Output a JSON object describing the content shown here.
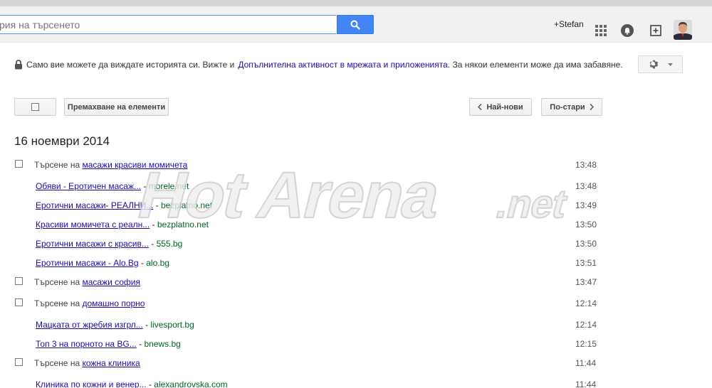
{
  "search": {
    "placeholder": "рия на търсенето"
  },
  "header": {
    "user_label": "+Stefan"
  },
  "notice": {
    "text_before": "Само вие можете да виждате историята си. Вижте и",
    "link": "Допълнителна активност в мрежата и приложенията",
    "text_after": ". За някои елементи може да има забавяне."
  },
  "toolbar": {
    "remove_label": "Премахване на елементи",
    "newer_label": "Най-нови",
    "older_label": "По-стари"
  },
  "date_heading": "16 ноември 2014",
  "history": [
    {
      "kind": "query",
      "prefix": "Търсене на ",
      "term": "масажи красиви момичета",
      "time": "13:48"
    },
    {
      "kind": "result",
      "title": "Обяви - Еротичен масаж...",
      "domain": "morele.net",
      "time": "13:48"
    },
    {
      "kind": "result",
      "title": "Еротични масажи- РЕАЛНИ...",
      "domain": "bezplatno.net",
      "time": "13:49"
    },
    {
      "kind": "result",
      "title": "Красиви момичета с реалн...",
      "domain": "bezplatno.net",
      "time": "13:50"
    },
    {
      "kind": "result",
      "title": "Еротични масажи с красив...",
      "domain": "555.bg",
      "time": "13:50"
    },
    {
      "kind": "result",
      "title": "Еротични масажи - Alo.Bg",
      "domain": "alo.bg",
      "time": "13:51"
    },
    {
      "kind": "query",
      "prefix": "Търсене на ",
      "term": "масажи софия",
      "time": "13:47"
    },
    {
      "kind": "query",
      "prefix": "Търсене на ",
      "term": "домашно порно",
      "time": "12:14"
    },
    {
      "kind": "result",
      "title": "Мацката от жребия изгрл...",
      "domain": "livesport.bg",
      "time": "12:14"
    },
    {
      "kind": "result",
      "title": "Топ 3 на порното на BG...",
      "domain": "bnews.bg",
      "time": "12:15"
    },
    {
      "kind": "query",
      "prefix": "Търсене на ",
      "term": "кожна клиника",
      "time": "11:44"
    },
    {
      "kind": "result",
      "title": "Клиника по кожни и венер...",
      "domain": "alexandrovska.com",
      "time": "11:44"
    }
  ],
  "watermark": "Hot Arena.net",
  "colors": {
    "accent": "#4285f4",
    "link": "#1a0dab",
    "domain": "#006621"
  },
  "icons": [
    "search-icon",
    "apps-grid-icon",
    "notifications-icon",
    "share-plus-icon",
    "lock-icon",
    "gear-icon",
    "chevron-left-icon",
    "chevron-right-icon"
  ]
}
